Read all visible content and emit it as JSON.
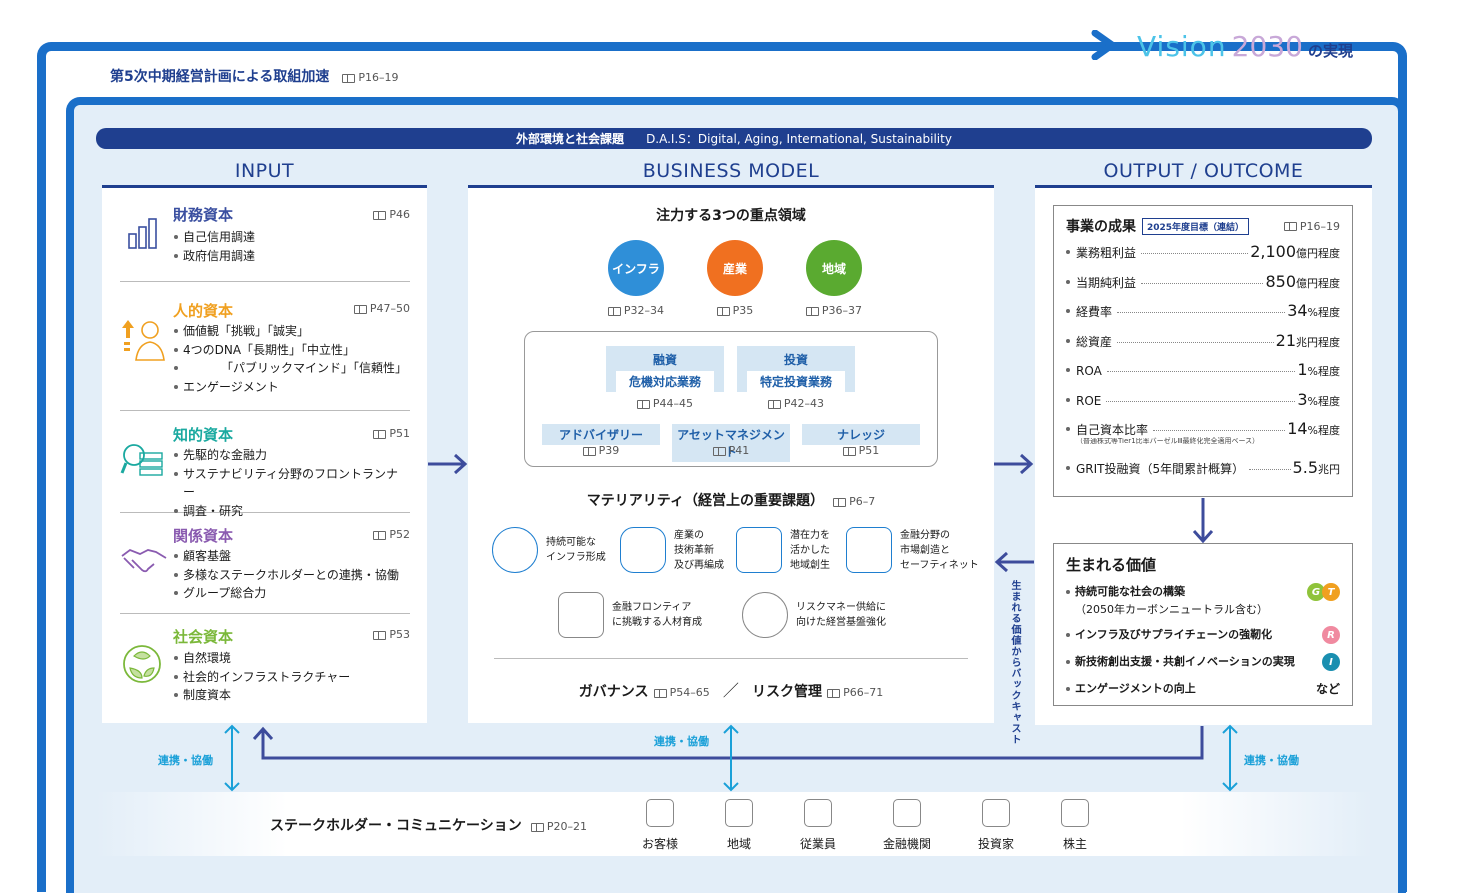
{
  "header": {
    "plan_title": "第5次中期経営計画による取組加速",
    "plan_ref": "P16–19",
    "vision_word": "Vision",
    "vision_year": "2030",
    "vision_suffix": "の実現"
  },
  "banner": {
    "label": "外部環境と社会課題",
    "text": "D.A.I.S：Digital, Aging, International, Sustainability"
  },
  "sections": {
    "input": "INPUT",
    "business": "BUSINESS MODEL",
    "output": "OUTPUT / OUTCOME"
  },
  "capitals": [
    {
      "title": "財務資本",
      "ref": "P46",
      "color": "#3a4fa0",
      "icon": "bar-chart-icon",
      "items": [
        "自己信用調達",
        "政府信用調達"
      ]
    },
    {
      "title": "人的資本",
      "ref": "P47–50",
      "color": "#f0a020",
      "icon": "person-growth-icon",
      "items": [
        "価値観「挑戦」「誠実」",
        "4つのDNA「長期性」「中立性」",
        "「パブリックマインド」「信頼性」",
        "エンゲージメント"
      ]
    },
    {
      "title": "知的資本",
      "ref": "P51",
      "color": "#1aa9a0",
      "icon": "knowledge-icon",
      "items": [
        "先駆的な金融力",
        "サステナビリティ分野のフロントランナー",
        "調査・研究"
      ]
    },
    {
      "title": "関係資本",
      "ref": "P52",
      "color": "#8a5bb0",
      "icon": "handshake-icon",
      "items": [
        "顧客基盤",
        "多様なステークホルダーとの連携・協働",
        "グループ総合力"
      ]
    },
    {
      "title": "社会資本",
      "ref": "P53",
      "color": "#7bb83a",
      "icon": "recycle-icon",
      "items": [
        "自然環境",
        "社会的インフラストラクチャー",
        "制度資本"
      ]
    }
  ],
  "business": {
    "focus_title": "注力する3つの重点領域",
    "areas": [
      {
        "label": "インフラ",
        "ref": "P32–34",
        "color": "#2f8fd8"
      },
      {
        "label": "産業",
        "ref": "P35",
        "color": "#f07020"
      },
      {
        "label": "地域",
        "ref": "P36–37",
        "color": "#5aaa30"
      }
    ],
    "finance": {
      "title": "融資",
      "sub": "危機対応業務",
      "ref": "P44–45"
    },
    "invest": {
      "title": "投資",
      "sub": "特定投資業務",
      "ref": "P42–43"
    },
    "services": [
      {
        "label": "アドバイザリー",
        "ref": "P39"
      },
      {
        "label": "アセットマネジメント",
        "ref": "P41"
      },
      {
        "label": "ナレッジ",
        "ref": "P51"
      }
    ],
    "materiality_title": "マテリアリティ（経営上の重要課題）",
    "materiality_ref": "P6–7",
    "materiality": [
      {
        "lines": [
          "持続可能な",
          "インフラ形成"
        ],
        "icon": "infrastructure-icon"
      },
      {
        "lines": [
          "産業の",
          "技術革新",
          "及び再編成"
        ],
        "icon": "atom-icon"
      },
      {
        "lines": [
          "潜在力を",
          "活かした",
          "地域創生"
        ],
        "icon": "community-icon"
      },
      {
        "lines": [
          "金融分野の",
          "市場創造と",
          "セーフティネット"
        ],
        "icon": "safety-net-icon"
      },
      {
        "lines": [
          "金融フロンティア",
          "に挑戦する人材育成"
        ],
        "icon": "people-icon"
      },
      {
        "lines": [
          "リスクマネー供給に",
          "向けた経営基盤強化"
        ],
        "icon": "gear-coin-icon"
      }
    ],
    "governance": "ガバナンス",
    "governance_ref": "P54–65",
    "slash": "／",
    "risk": "リスク管理",
    "risk_ref": "P66–71"
  },
  "output": {
    "results_title": "事業の成果",
    "target_badge": "2025年度目標（連結）",
    "results_ref": "P16–19",
    "metrics": [
      {
        "label": "業務粗利益",
        "value": "2,100",
        "unit": "億円程度"
      },
      {
        "label": "当期純利益",
        "value": "850",
        "unit": "億円程度"
      },
      {
        "label": "経費率",
        "value": "34",
        "unit": "%程度"
      },
      {
        "label": "総資産",
        "value": "21",
        "unit": "兆円程度"
      },
      {
        "label": "ROA",
        "value": "1",
        "unit": "%程度"
      },
      {
        "label": "ROE",
        "value": "3",
        "unit": "%程度"
      },
      {
        "label": "自己資本比率",
        "value": "14",
        "unit": "%程度",
        "note": "（普通株式等Tier1比率バーゼルⅢ最終化完全適用ベース）"
      },
      {
        "label": "GRIT投融資（5年間累計概算）",
        "value": "5.5",
        "unit": "兆円"
      }
    ],
    "value_title": "生まれる価値",
    "values": [
      {
        "text": "持続可能な社会の構築",
        "sub": "（2050年カーボンニュートラル含む）",
        "glyphs": [
          {
            "t": "G",
            "c": "#8fc33a"
          },
          {
            "t": "T",
            "c": "#f0a020"
          }
        ]
      },
      {
        "text": "インフラ及びサプライチェーンの強靭化",
        "glyphs": [
          {
            "t": "R",
            "c": "#f08aa0"
          }
        ]
      },
      {
        "text": "新技術創出支援・共創イノベーションの実現",
        "glyphs": [
          {
            "t": "I",
            "c": "#1a8fb0"
          }
        ]
      },
      {
        "text": "エンゲージメントの向上",
        "suffix": "など",
        "glyphs": []
      }
    ]
  },
  "backcast": "生まれる価値からバックキャスト",
  "collab": "連携・協働",
  "stakeholders": {
    "title": "ステークホルダー・コミュニケーション",
    "ref": "P20–21",
    "items": [
      {
        "label": "お客様",
        "icon": "customers-icon"
      },
      {
        "label": "地域",
        "icon": "region-icon"
      },
      {
        "label": "従業員",
        "icon": "employees-icon"
      },
      {
        "label": "金融機関",
        "icon": "bank-icon"
      },
      {
        "label": "投資家",
        "icon": "investor-icon"
      },
      {
        "label": "株主",
        "icon": "shareholders-icon"
      }
    ]
  }
}
